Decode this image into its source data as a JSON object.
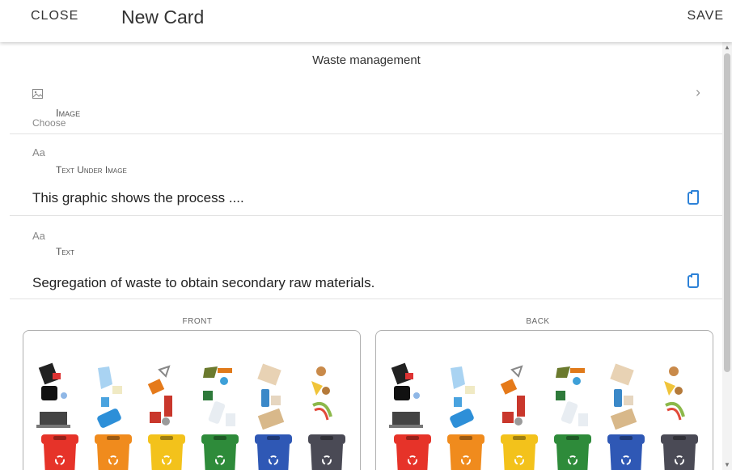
{
  "header": {
    "close_label": "CLOSE",
    "title": "New Card",
    "save_label": "SAVE"
  },
  "section_title": "Waste management",
  "image_field": {
    "icon": "image-icon",
    "label": "Image",
    "sub": "Choose"
  },
  "text_under_image": {
    "icon_text": "Aa",
    "label": "Text Under Image",
    "value": "This graphic shows the process ...."
  },
  "text_field": {
    "icon_text": "Aa",
    "label": "Text",
    "value": "Segregation of waste to obtain secondary raw materials."
  },
  "preview": {
    "front_label": "FRONT",
    "back_label": "BACK"
  },
  "bins": [
    {
      "color": "#e63329",
      "label": "red-bin"
    },
    {
      "color": "#f08b1d",
      "label": "orange-bin"
    },
    {
      "color": "#f3c21b",
      "label": "yellow-bin"
    },
    {
      "color": "#2e8b3a",
      "label": "green-bin"
    },
    {
      "color": "#2f58b5",
      "label": "blue-bin"
    },
    {
      "color": "#4a4a55",
      "label": "gray-bin"
    }
  ]
}
